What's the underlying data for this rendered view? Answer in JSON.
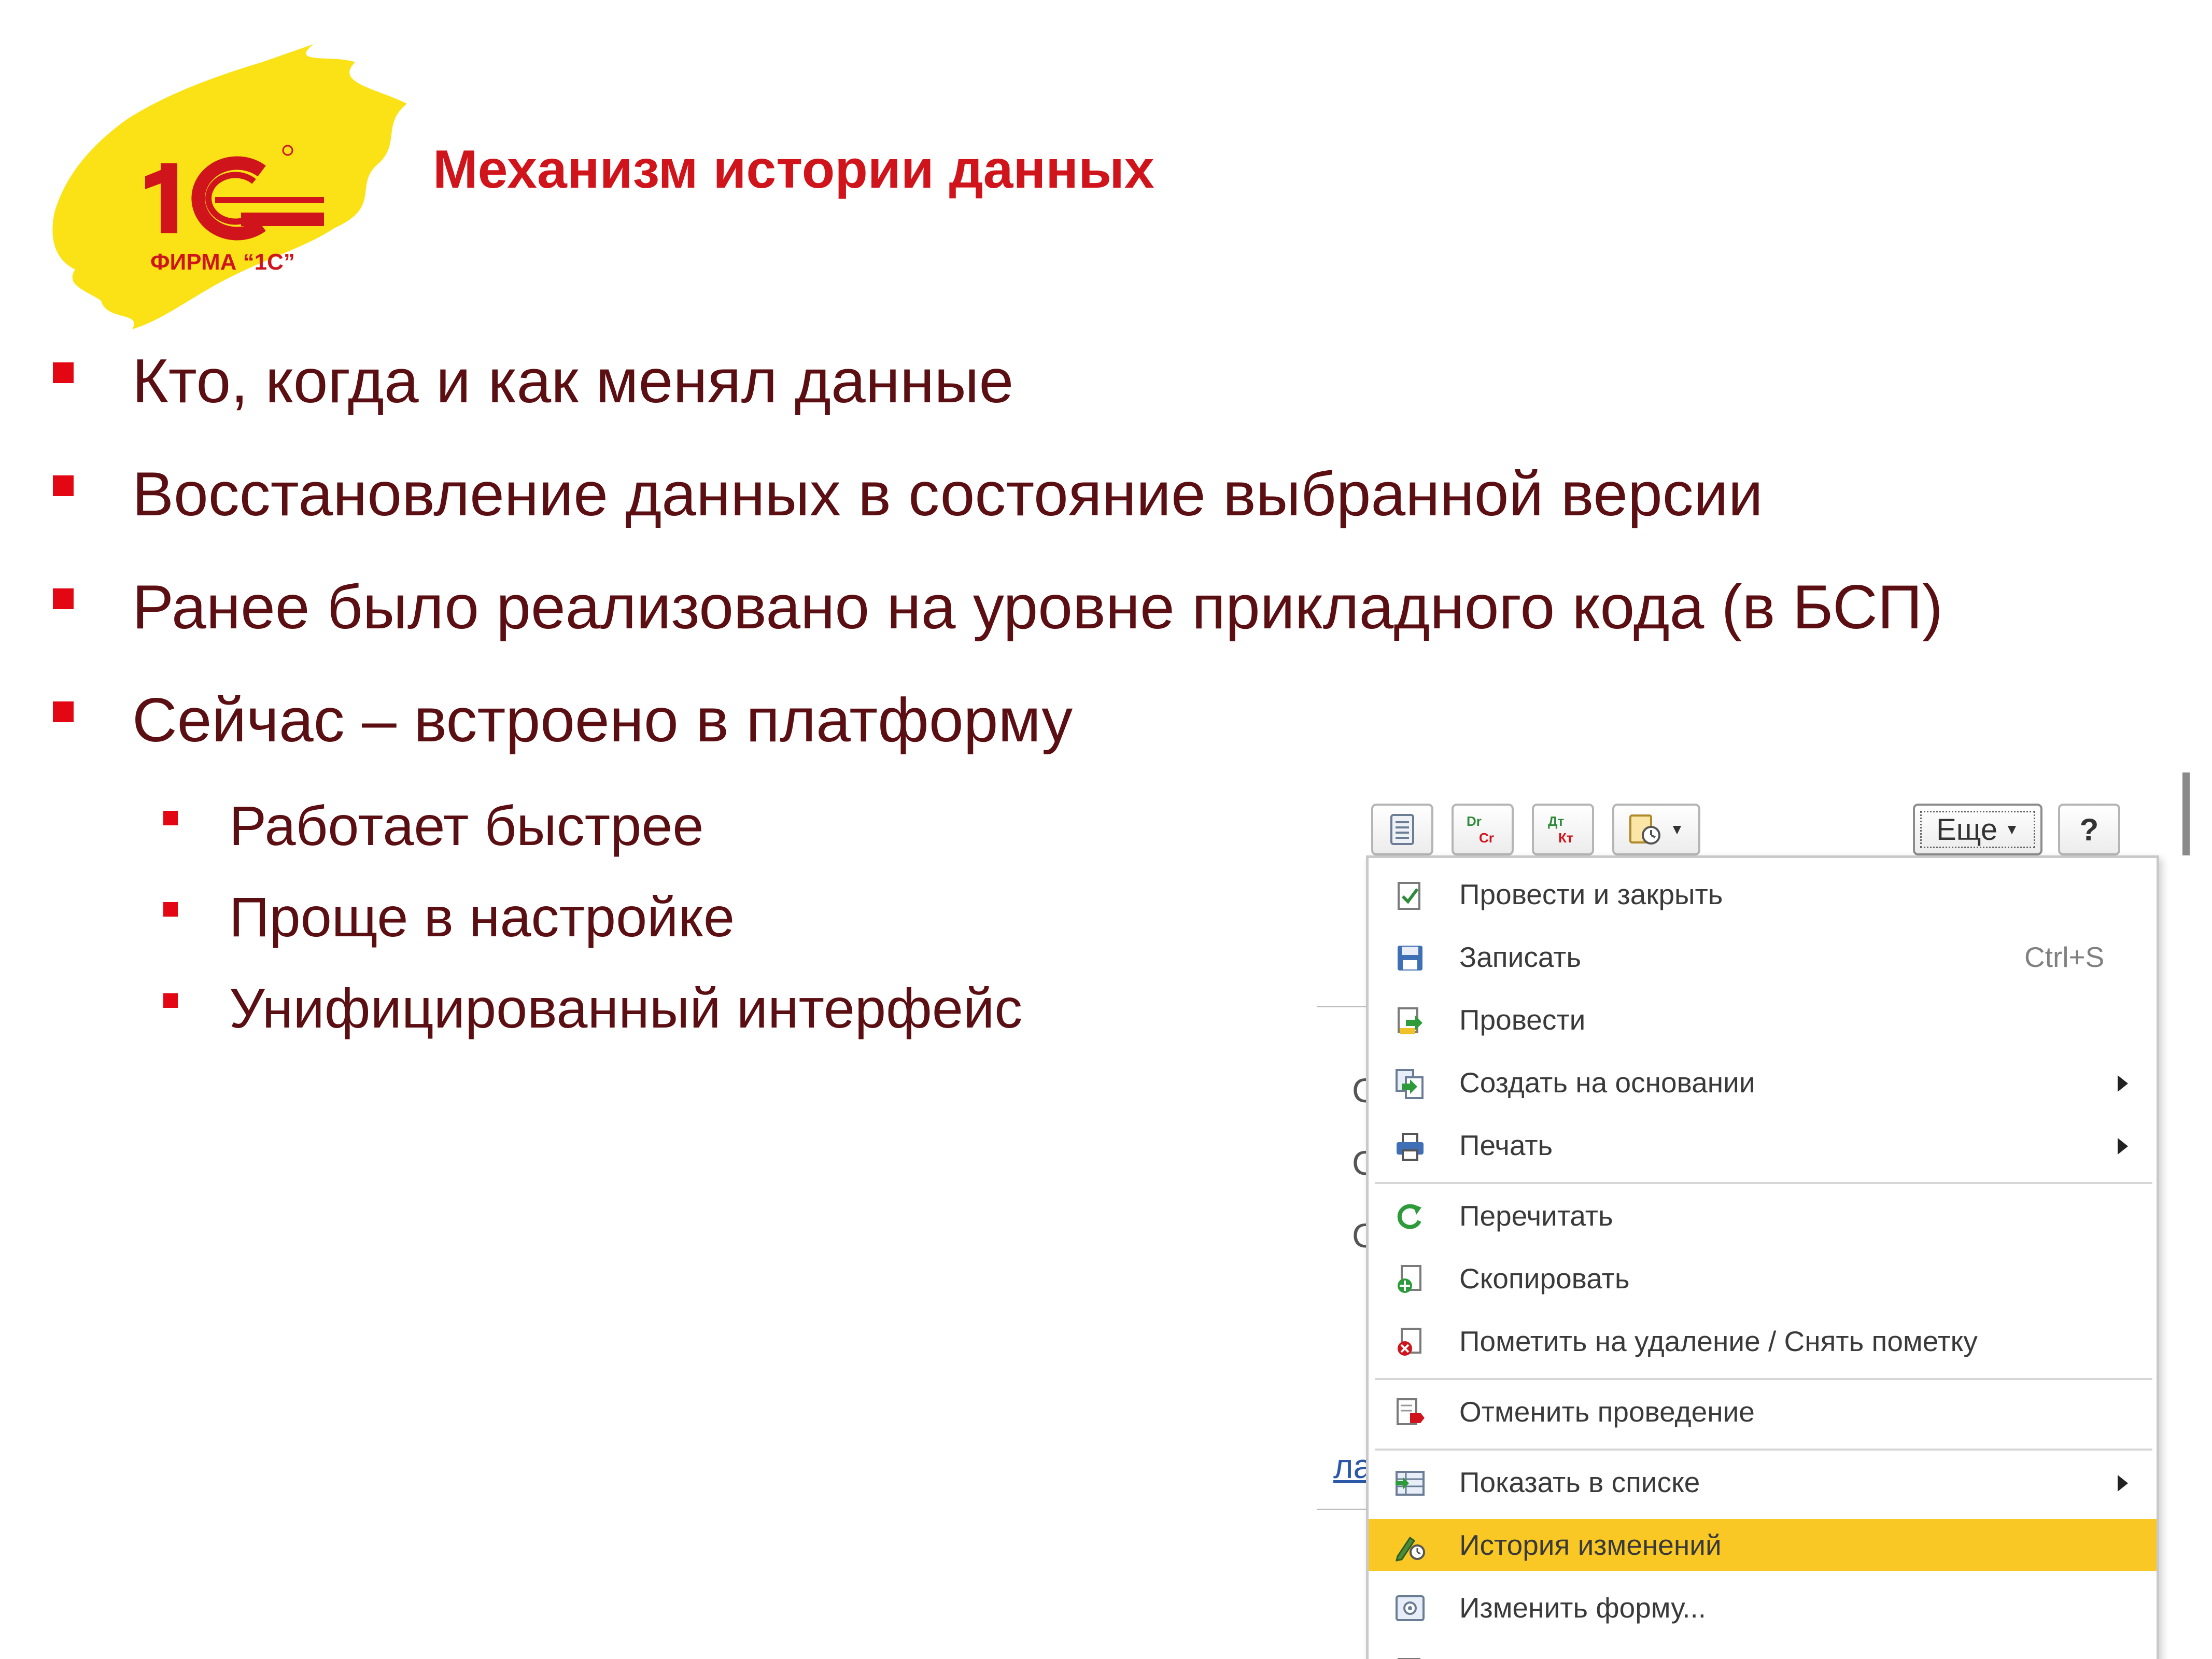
{
  "slide": {
    "title": "Механизм истории данных",
    "logo_text": "ФИРМА “1С”",
    "logo_mark": "1С",
    "bullets": [
      "Кто, когда и как менял данные",
      "Восстановление данных в состояние выбранной версии",
      "Ранее было реализовано на уровне прикладного кода (в БСП)",
      "Сейчас – встроено в платформу"
    ],
    "sub_bullets": [
      "Работает быстрее",
      "Проще в настройке",
      "Унифицированный интерфейс"
    ]
  },
  "toolbar": {
    "buttons": [
      {
        "icon": "document-list-icon"
      },
      {
        "icon": "dr-cr-icon",
        "text_top": "Dr",
        "text_bottom": "Cr"
      },
      {
        "icon": "dt-kt-icon",
        "text_top": "Дт",
        "text_bottom": "Кт"
      },
      {
        "icon": "report-dropdown-icon"
      }
    ],
    "more_label": "Еще",
    "help_label": "?"
  },
  "menu": {
    "items": [
      {
        "label": "Провести и закрыть",
        "icon": "post-and-close-icon"
      },
      {
        "label": "Записать",
        "icon": "save-icon",
        "shortcut": "Ctrl+S"
      },
      {
        "label": "Провести",
        "icon": "post-icon"
      },
      {
        "label": "Создать на основании",
        "icon": "create-based-on-icon",
        "submenu": true
      },
      {
        "label": "Печать",
        "icon": "print-icon",
        "submenu": true
      },
      {
        "label": "Перечитать",
        "icon": "reread-icon"
      },
      {
        "label": "Скопировать",
        "icon": "copy-icon"
      },
      {
        "label": "Пометить на удаление / Снять пометку",
        "icon": "mark-deletion-icon"
      },
      {
        "label": "Отменить проведение",
        "icon": "cancel-posting-icon"
      },
      {
        "label": "Показать в списке",
        "icon": "show-in-list-icon",
        "submenu": true
      },
      {
        "label": "История изменений",
        "icon": "change-history-icon",
        "highlighted": true
      },
      {
        "label": "Изменить форму...",
        "icon": "change-form-icon"
      }
    ]
  },
  "background_fragments": [
    "С",
    "С",
    "С",
    "ла"
  ],
  "colors": {
    "title": "#d0141b",
    "body_text": "#5b0f13",
    "bullet": "#e30613",
    "logo_yellow": "#fbe216",
    "logo_red": "#d0141b",
    "menu_highlight": "#f9c825"
  }
}
